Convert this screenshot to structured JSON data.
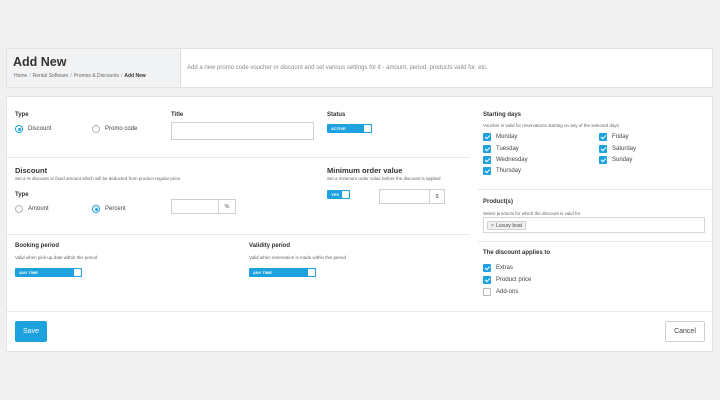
{
  "header": {
    "title": "Add New",
    "breadcrumb": [
      "Home",
      "Rental Software",
      "Promos & Discounts",
      "Add New"
    ],
    "description": "Add a new promo code voucher or discount and set various settings for it - amount, period, products valid for, etc."
  },
  "form": {
    "type": {
      "label": "Type",
      "options": [
        "Discount",
        "Promo code"
      ],
      "selected": "Discount"
    },
    "title": {
      "label": "Title",
      "value": ""
    },
    "status": {
      "label": "Status",
      "toggle": "ACTIVE"
    },
    "discount": {
      "label": "Discount",
      "hint": "Set a % discount or fixed amount which will be deducted from product regular price",
      "type_label": "Type",
      "options": [
        "Amount",
        "Percent"
      ],
      "selected": "Percent",
      "value": "",
      "unit": "%"
    },
    "min_order": {
      "label": "Minimum order value",
      "hint": "Set a minimum order value before the discount is applied",
      "toggle": "YES",
      "value": "",
      "unit": "$"
    },
    "booking_period": {
      "label": "Booking period",
      "hint": "Valid when pick-up date within this period",
      "toggle": "ANY TIME"
    },
    "validity_period": {
      "label": "Validity period",
      "hint": "Valid when reservation is made within this period",
      "toggle": "ANY TIME"
    }
  },
  "starting_days": {
    "label": "Starting days",
    "hint": "Voucher is valid for reservations starting on any of the selected days",
    "days": [
      {
        "name": "Monday",
        "checked": true
      },
      {
        "name": "Tuesday",
        "checked": true
      },
      {
        "name": "Wednesday",
        "checked": true
      },
      {
        "name": "Thursday",
        "checked": true
      },
      {
        "name": "Friday",
        "checked": true
      },
      {
        "name": "Saturday",
        "checked": true
      },
      {
        "name": "Sunday",
        "checked": true
      }
    ]
  },
  "products": {
    "label": "Product(s)",
    "hint": "Select products for which the discount is valid for",
    "tags": [
      "Luxury boat"
    ],
    "tag_remove": "×"
  },
  "applies_to": {
    "label": "The discount applies to",
    "items": [
      {
        "name": "Extras",
        "checked": true
      },
      {
        "name": "Product price",
        "checked": true
      },
      {
        "name": "Add-ons",
        "checked": false
      }
    ]
  },
  "actions": {
    "save": "Save",
    "cancel": "Cancel"
  },
  "colors": {
    "accent": "#1ea1df",
    "background": "#f0f0f0"
  }
}
